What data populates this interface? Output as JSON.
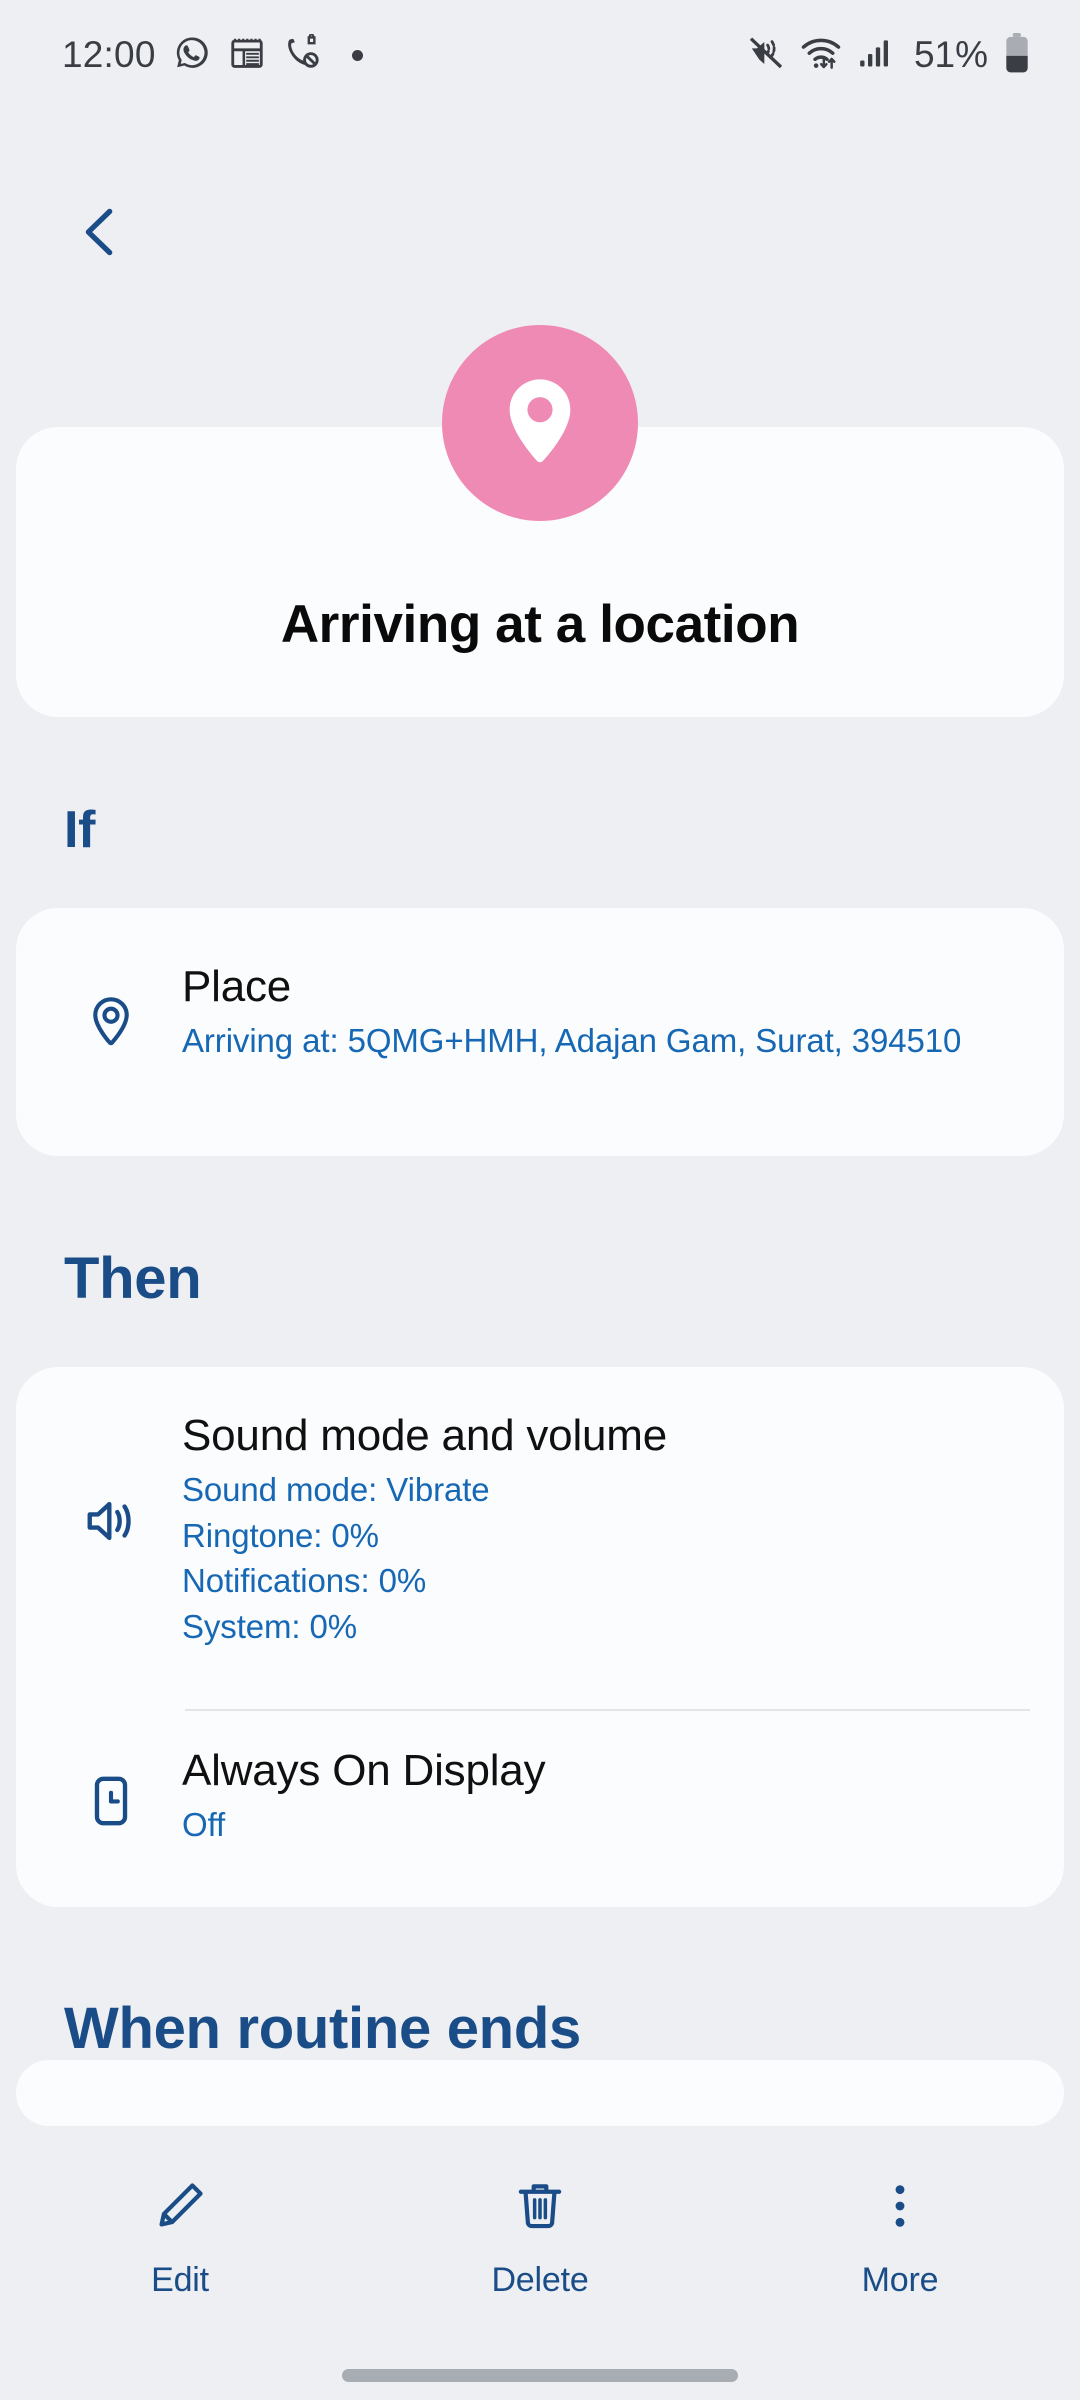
{
  "statusbar": {
    "time": "12:00",
    "battery_percent": "51%",
    "left_icons": [
      "whatsapp-icon",
      "notepad-icon",
      "call-blocked-icon",
      "more-dot-icon"
    ],
    "right_icons": [
      "vibrate-icon",
      "wifi-icon",
      "signal-icon",
      "battery-icon"
    ]
  },
  "nav": {
    "back_icon": "chevron-left-icon"
  },
  "header": {
    "avatar_icon": "location-pin-icon",
    "avatar_color": "#ef8ab4",
    "title": "Arriving at a location"
  },
  "sections": {
    "if_label": "If",
    "then_label": "Then",
    "when_routine_ends_label": "When routine ends"
  },
  "if_card": {
    "rows": [
      {
        "icon": "location-pin-outline-icon",
        "title": "Place",
        "subtitle": "Arriving at: 5QMG+HMH, Adajan Gam, Surat, 394510"
      }
    ]
  },
  "then_card": {
    "rows": [
      {
        "icon": "speaker-volume-icon",
        "title": "Sound mode and volume",
        "sub_lines": [
          "Sound mode: Vibrate",
          "Ringtone: 0%",
          "Notifications: 0%",
          "System: 0%"
        ]
      },
      {
        "icon": "always-on-display-icon",
        "title": "Always On Display",
        "subtitle": "Off"
      }
    ]
  },
  "bottombar": {
    "items": [
      {
        "label": "Edit",
        "icon": "pencil-icon"
      },
      {
        "label": "Delete",
        "icon": "trash-icon"
      },
      {
        "label": "More",
        "icon": "more-vertical-icon"
      }
    ]
  },
  "colors": {
    "background": "#edeff3",
    "card": "#fbfcfd",
    "accent_blue": "#1a4c87",
    "link_blue": "#1668b4",
    "pink": "#ef8ab4",
    "text": "#101010"
  }
}
